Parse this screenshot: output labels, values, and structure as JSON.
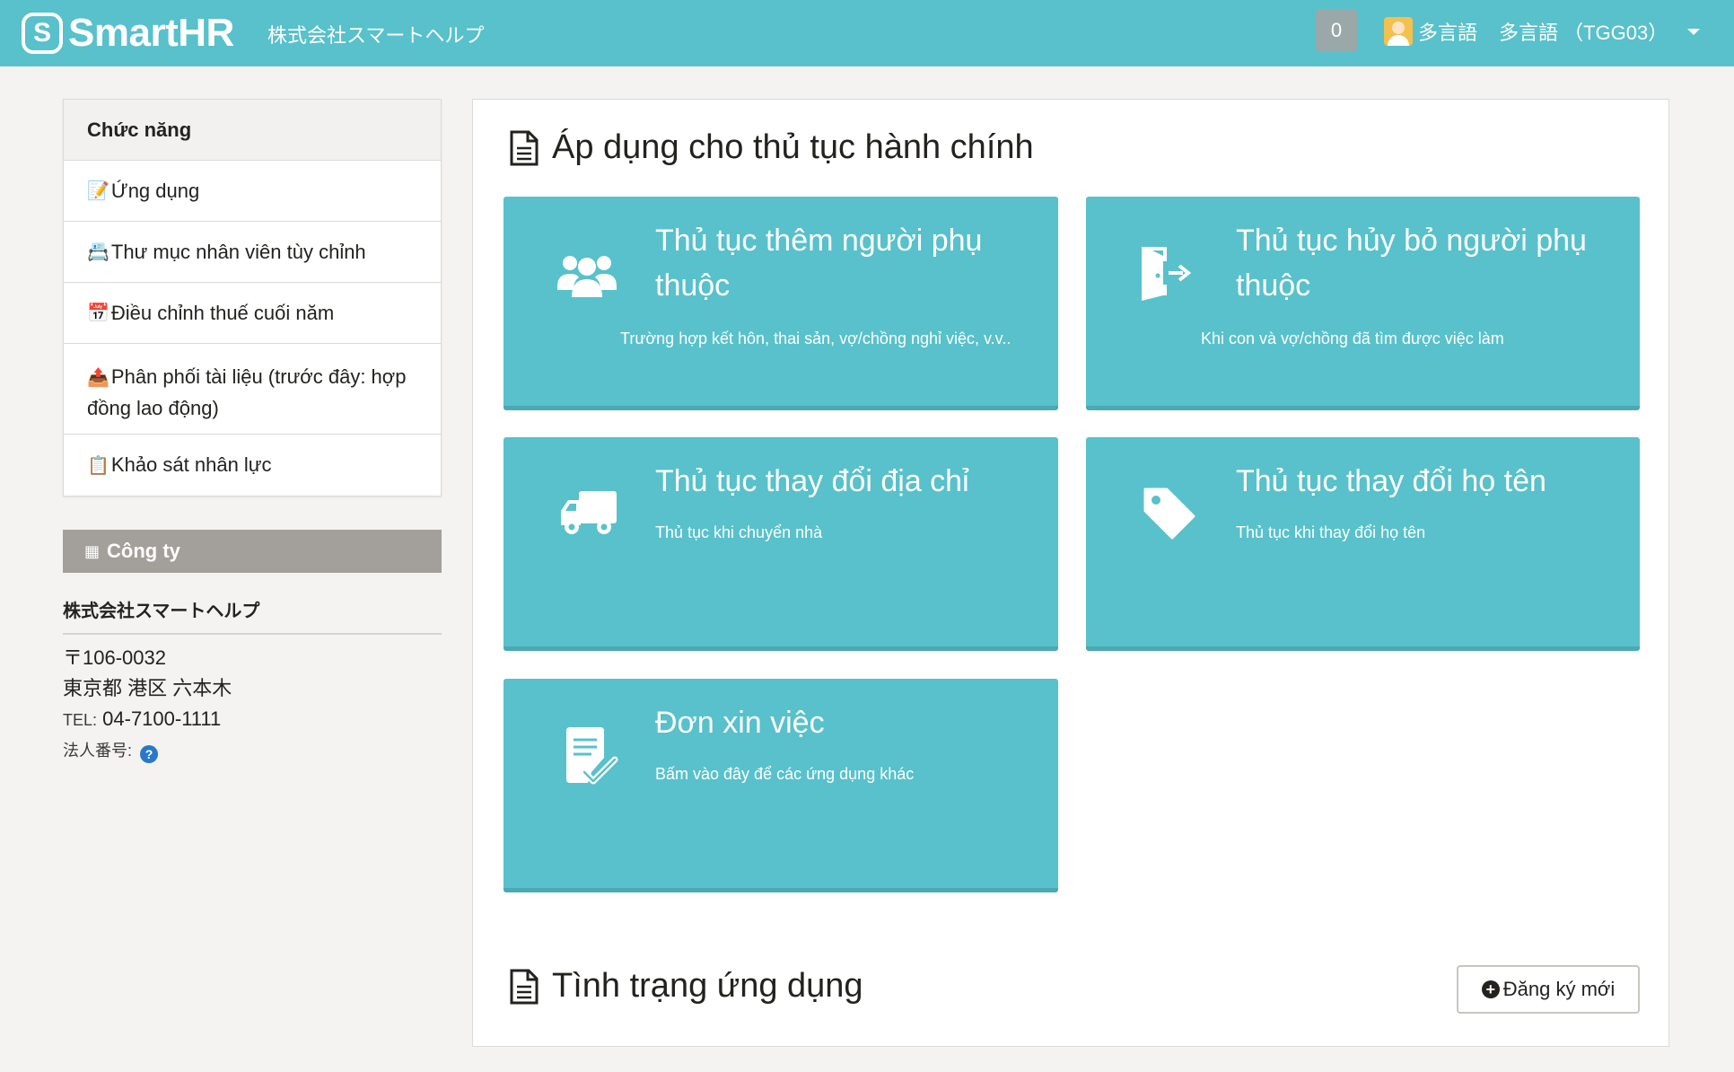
{
  "header": {
    "logo_text": "SmartHR",
    "logo_mark": "S",
    "tenant_name": "株式会社スマートヘルプ",
    "notification_count": "0",
    "user_short": "多言語",
    "user_full": "多言語 （TGG03）"
  },
  "sidebar": {
    "menu_title": "Chức năng",
    "items": [
      {
        "icon": "application-icon",
        "glyph": "📝",
        "label": "Ứng dụng"
      },
      {
        "icon": "employee-directory-icon",
        "glyph": "📇",
        "label": "Thư mục nhân viên tùy chỉnh"
      },
      {
        "icon": "calendar-check-icon",
        "glyph": "📅",
        "label": "Điều chỉnh thuế cuối năm"
      },
      {
        "icon": "document-distribution-icon",
        "glyph": "📤",
        "label": "Phân phối tài liệu (trước đây: hợp đồng lao động)"
      },
      {
        "icon": "survey-clipboard-icon",
        "glyph": "📋",
        "label": "Khảo sát nhân lực"
      }
    ],
    "company_section_title": "Công ty",
    "company_name": "株式会社スマートヘルプ",
    "postal": "〒106-0032",
    "address": "東京都 港区 六本木",
    "tel_label": "TEL:",
    "tel": "04-7100-1111",
    "corp_number_label": "法人番号:",
    "help_glyph": "?"
  },
  "main": {
    "section_title": "Áp dụng cho thủ tục hành chính",
    "cards": [
      {
        "title": "Thủ tục thêm người phụ thuộc",
        "desc": "Trường hợp kết hôn, thai sản, vợ/chồng nghỉ việc, v.v..",
        "icon": "users-group-icon"
      },
      {
        "title": "Thủ tục hủy bỏ người phụ thuộc",
        "desc": "Khi con và vợ/chồng đã tìm được việc làm",
        "icon": "door-exit-icon"
      },
      {
        "title": "Thủ tục thay đổi địa chỉ",
        "desc": "Thủ tục khi chuyển nhà",
        "icon": "truck-icon"
      },
      {
        "title": "Thủ tục thay đổi họ tên",
        "desc": "Thủ tục khi thay đổi họ tên",
        "icon": "tag-icon"
      },
      {
        "title": "Đơn xin việc",
        "desc": "Bấm vào đây để các ứng dụng khác",
        "icon": "document-check-icon"
      }
    ],
    "status_title": "Tình trạng ứng dụng",
    "new_button_label": "Đăng ký mới"
  },
  "colors": {
    "brand": "#58c1cb",
    "card_border": "#4aa9b2",
    "company_header": "#a3a09b",
    "background": "#f4f3f2"
  }
}
